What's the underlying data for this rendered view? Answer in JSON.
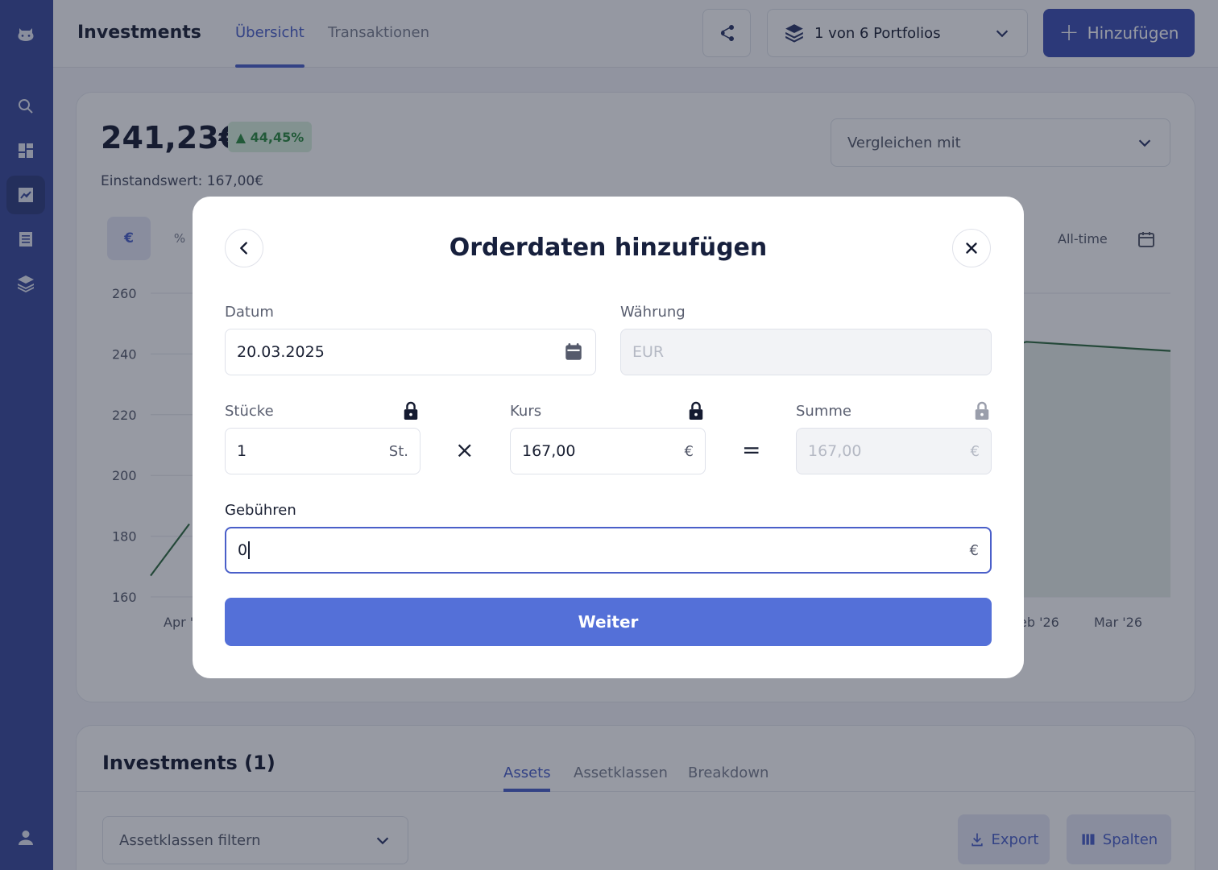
{
  "topbar": {
    "title": "Investments",
    "tabs": [
      "Übersicht",
      "Transaktionen"
    ],
    "portfolio_select": "1 von 6 Portfolios",
    "add_button": "Hinzufügen"
  },
  "summary": {
    "value": "241,23€",
    "change": "44,45%",
    "cost_basis": "Einstandswert: 167,00€",
    "compare_placeholder": "Vergleichen mit",
    "toggle_eur": "€",
    "toggle_pct": "%",
    "range": "All-time"
  },
  "chart_data": {
    "type": "area",
    "y_ticks": [
      "260",
      "240",
      "220",
      "200",
      "180",
      "160"
    ],
    "x_ticks_visible": [
      "Apr '",
      "eb '26",
      "Mar '26"
    ],
    "ylim": [
      160,
      260
    ],
    "series_color": "#2e6b3e",
    "visible_points_left": [
      [
        0,
        167
      ],
      [
        0.4,
        184
      ]
    ],
    "visible_points_right": [
      [
        0.8,
        230
      ],
      [
        0.9,
        244
      ],
      [
        1.0,
        241
      ]
    ]
  },
  "investments": {
    "title": "Investments (1)",
    "tabs": [
      "Assets",
      "Assetklassen",
      "Breakdown"
    ],
    "filter_placeholder": "Assetklassen filtern",
    "export_button": "Export",
    "columns_button": "Spalten"
  },
  "modal": {
    "title": "Orderdaten hinzufügen",
    "date_label": "Datum",
    "date_value": "20.03.2025",
    "currency_label": "Währung",
    "currency_value": "EUR",
    "pieces_label": "Stücke",
    "pieces_value": "1",
    "pieces_suffix": "St.",
    "price_label": "Kurs",
    "price_value": "167,00",
    "price_suffix": "€",
    "sum_label": "Summe",
    "sum_value": "167,00",
    "sum_suffix": "€",
    "fees_label": "Gebühren",
    "fees_value": "0",
    "fees_suffix": "€",
    "times_symbol": "×",
    "equals_symbol": "=",
    "submit": "Weiter"
  }
}
